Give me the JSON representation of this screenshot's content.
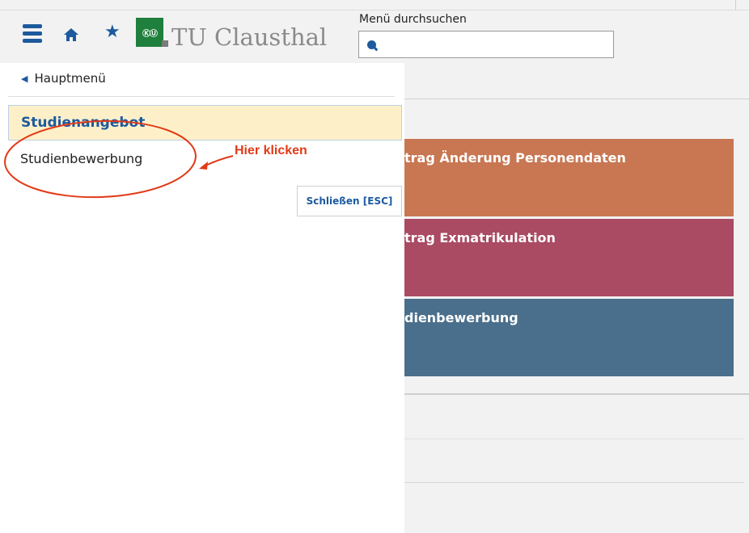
{
  "header": {
    "logo_text": "TU Clausthal",
    "search_label": "Menü durchsuchen",
    "search_value": "",
    "icons": [
      "hamburger-menu-icon",
      "home-icon",
      "star-icon",
      "search-icon"
    ]
  },
  "sidemenu": {
    "back_label": "Hauptmenü",
    "heading": "Studienangebot",
    "items": [
      {
        "label": "Studienbewerbung"
      }
    ],
    "close_label": "Schließen [ESC]"
  },
  "annotation": {
    "text": "Hier klicken",
    "color": "#e23a17"
  },
  "tiles": [
    {
      "label": "trag Änderung Personendaten",
      "color": "#c87752"
    },
    {
      "label": "trag Exmatrikulation",
      "color": "#aa4a63"
    },
    {
      "label": "dienbewerbung",
      "color": "#4a6f8c"
    }
  ],
  "colors": {
    "brand_blue": "#1d5a9e",
    "logo_green": "#1f7f3c",
    "highlight_bg": "#fdf0c9"
  }
}
